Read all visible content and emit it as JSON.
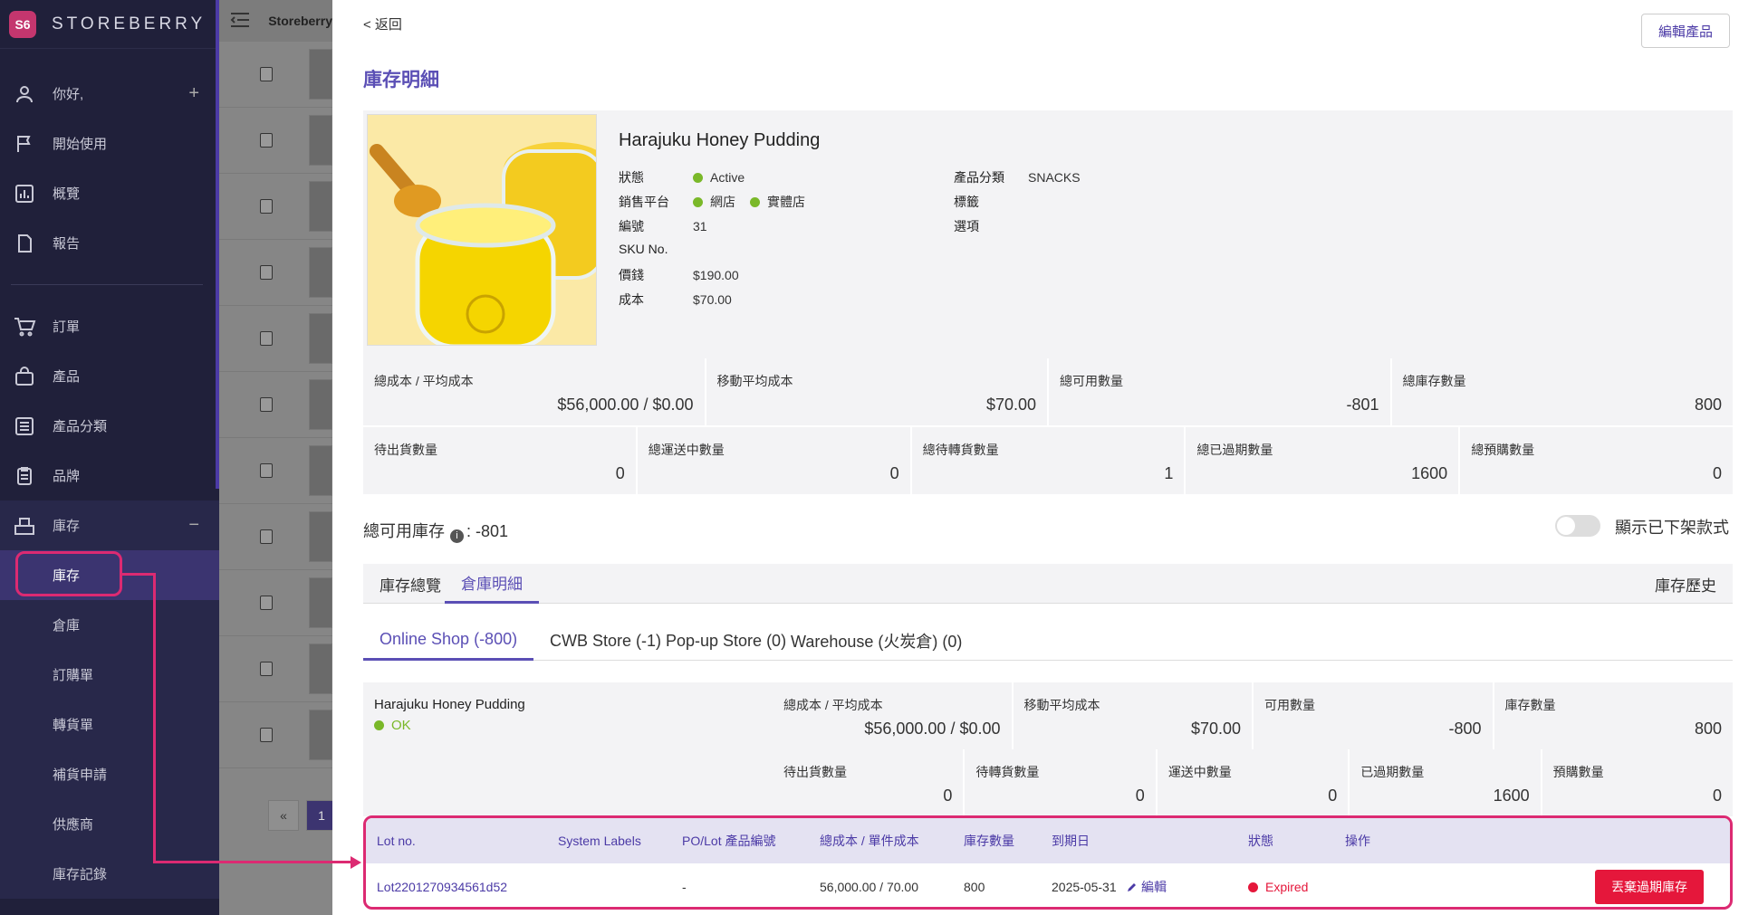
{
  "app": {
    "brand": "STOREBERRY",
    "logo_text": "S6",
    "breadcrumb": "Storeberry"
  },
  "sidebar": {
    "items": [
      {
        "label": "你好,",
        "icon": "user-icon"
      },
      {
        "label": "開始使用",
        "icon": "flag-icon"
      },
      {
        "label": "概覽",
        "icon": "chart-icon"
      },
      {
        "label": "報告",
        "icon": "document-icon"
      },
      {
        "label": "訂單",
        "icon": "cart-icon"
      },
      {
        "label": "產品",
        "icon": "bag-icon"
      },
      {
        "label": "產品分類",
        "icon": "list-icon"
      },
      {
        "label": "品牌",
        "icon": "clipboard-icon"
      },
      {
        "label": "庫存",
        "icon": "inventory-icon"
      }
    ],
    "plus": "+",
    "minus": "−",
    "sub_items": [
      "庫存",
      "倉庫",
      "訂購單",
      "轉貨單",
      "補貨申請",
      "供應商",
      "庫存記錄"
    ]
  },
  "list": {
    "pager": {
      "prev": "«",
      "page": "1"
    }
  },
  "header": {
    "back": "< 返回",
    "edit_button": "編輯產品",
    "title": "庫存明細"
  },
  "product": {
    "name": "Harajuku Honey Pudding",
    "labels": {
      "status": "狀態",
      "platform": "銷售平台",
      "code": "編號",
      "sku": "SKU No.",
      "price": "價錢",
      "cost": "成本",
      "category": "產品分類",
      "tags": "標籤",
      "options": "選項"
    },
    "status": "Active",
    "platforms": [
      "網店",
      "實體店"
    ],
    "code": "31",
    "price": "$190.00",
    "cost": "$70.00",
    "category": "SNACKS"
  },
  "stats": {
    "row1": [
      {
        "label": "總成本 / 平均成本",
        "value": "$56,000.00 / $0.00"
      },
      {
        "label": "移動平均成本",
        "value": "$70.00"
      },
      {
        "label": "總可用數量",
        "value": "-801"
      },
      {
        "label": "總庫存數量",
        "value": "800"
      }
    ],
    "row2": [
      {
        "label": "待出貨數量",
        "value": "0"
      },
      {
        "label": "總運送中數量",
        "value": "0"
      },
      {
        "label": "總待轉貨數量",
        "value": "1"
      },
      {
        "label": "總已過期數量",
        "value": "1600"
      },
      {
        "label": "總預購數量",
        "value": "0"
      }
    ]
  },
  "available": {
    "label": "總可用庫存",
    "info": "i",
    "value": ": -801"
  },
  "toggle": {
    "label": "顯示已下架款式",
    "on": false
  },
  "tabs": {
    "items": [
      "庫存總覽",
      "倉庫明細"
    ],
    "active": 1,
    "history": "庫存歷史"
  },
  "warehouse_tabs": [
    "Online Shop (-800)",
    "CWB Store (-1)",
    "Pop-up Store (0)",
    "Warehouse (火炭倉) (0)"
  ],
  "warehouse": {
    "name": "Harajuku Honey Pudding",
    "status": "OK",
    "row1": [
      {
        "label": "總成本 / 平均成本",
        "value": "$56,000.00 / $0.00"
      },
      {
        "label": "移動平均成本",
        "value": "$70.00"
      },
      {
        "label": "可用數量",
        "value": "-800"
      },
      {
        "label": "庫存數量",
        "value": "800"
      }
    ],
    "row2": [
      {
        "label": "待出貨數量",
        "value": "0"
      },
      {
        "label": "待轉貨數量",
        "value": "0"
      },
      {
        "label": "運送中數量",
        "value": "0"
      },
      {
        "label": "已過期數量",
        "value": "1600"
      },
      {
        "label": "預購數量",
        "value": "0"
      }
    ]
  },
  "lot_table": {
    "headers": [
      "Lot no.",
      "System Labels",
      "PO/Lot 產品編號",
      "總成本 / 單件成本",
      "庫存數量",
      "到期日",
      "狀態",
      "操作"
    ],
    "rows": [
      {
        "lot": "Lot2201270934561d52",
        "po": "-",
        "cost": "56,000.00 / 70.00",
        "qty": "800",
        "expiry": "2025-05-31",
        "edit": "編輯",
        "status": "Expired",
        "action": "丟棄過期庫存"
      }
    ]
  },
  "colors": {
    "accent": "#5b4fb5",
    "highlight": "#dc2a72",
    "danger": "#e5173b",
    "ok": "#7ab829",
    "sidebar": "#20203a"
  }
}
